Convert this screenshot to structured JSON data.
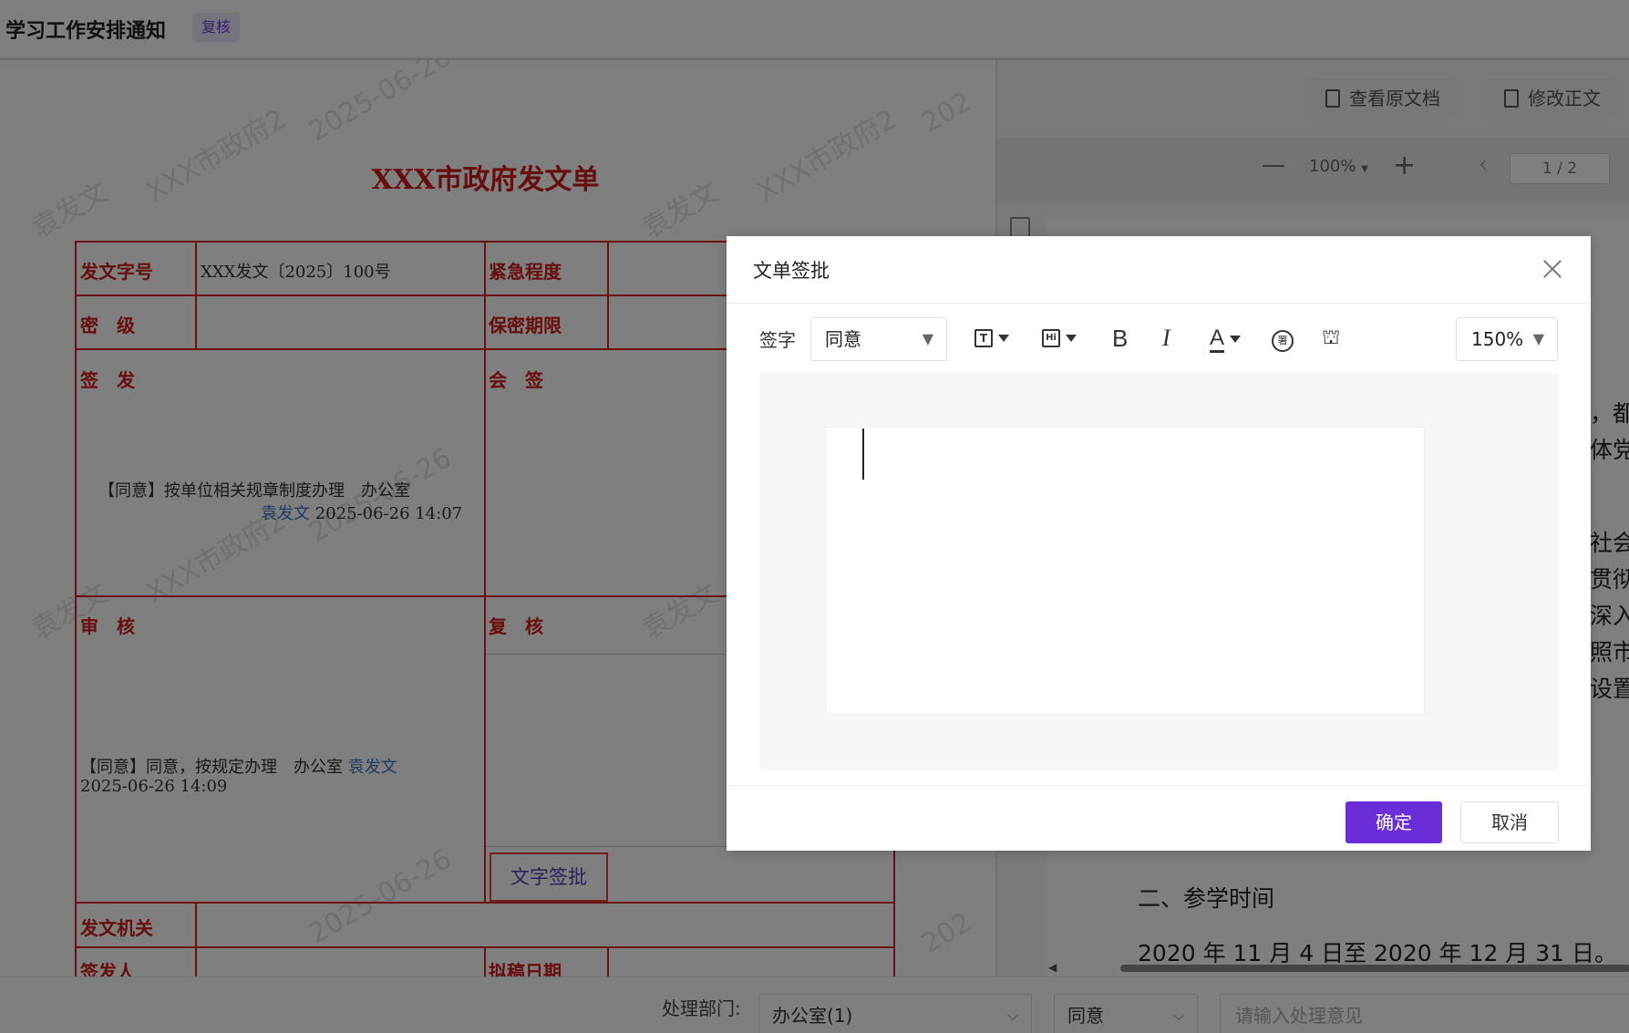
{
  "topbar": {
    "title": "学习工作安排通知",
    "badge": "复核"
  },
  "form": {
    "title": "XXX市政府发文单",
    "labels": {
      "doc_no": "发文字号",
      "urgency": "紧急程度",
      "secret": "密　级",
      "secret_period": "保密期限",
      "issue": "签　发",
      "countersign": "会　签",
      "audit": "审　核",
      "recheck": "复　核",
      "issuing_org": "发文机关",
      "signer": "签发人",
      "draft_date": "拟稿日期"
    },
    "doc_no_value": "XXX发文〔2025〕100号",
    "issue_opinion": "【同意】按单位相关规章制度办理　办公室",
    "issue_person": "袁发文",
    "issue_time": "2025-06-26 14:07",
    "audit_opinion_prefix": "【同意】同意，按规定办理　办公室",
    "audit_person": "袁发文",
    "audit_time": "2025-06-26 14:09",
    "text_sign_button": "文字签批",
    "watermarks": [
      "袁发文",
      "XXX市政府2",
      "2025-06-26",
      "202"
    ]
  },
  "viewer": {
    "view_original": "查看原文档",
    "edit_text": "修改正文",
    "zoom": "100%",
    "page": "1 / 2",
    "fragments": [
      "，都",
      "体党",
      "社会",
      "贯彻",
      "深入",
      "照市",
      "设置"
    ],
    "heading": "二、参学时间",
    "time_range": "2020 年 11 月 4 日至 2020 年 12 月 31 日。"
  },
  "bottombar": {
    "dept_label": "处理部门:",
    "dept_value": "办公室(1)",
    "opinion_value": "同意",
    "opinion_placeholder": "请输入处理意见"
  },
  "dialog": {
    "title": "文单签批",
    "sign_label": "签字",
    "sign_select": "同意",
    "zoom": "150%",
    "confirm": "确定",
    "cancel": "取消",
    "tool_text_icon": "T",
    "tool_handwrite_icon": "Hi",
    "tool_bold": "B",
    "tool_italic": "I",
    "tool_color": "A",
    "tool_seal": "署",
    "tool_stamp": "⛫"
  },
  "colors": {
    "form_red": "#d11a1a",
    "primary": "#6a2dd8",
    "link_blue": "#3a75c4"
  }
}
